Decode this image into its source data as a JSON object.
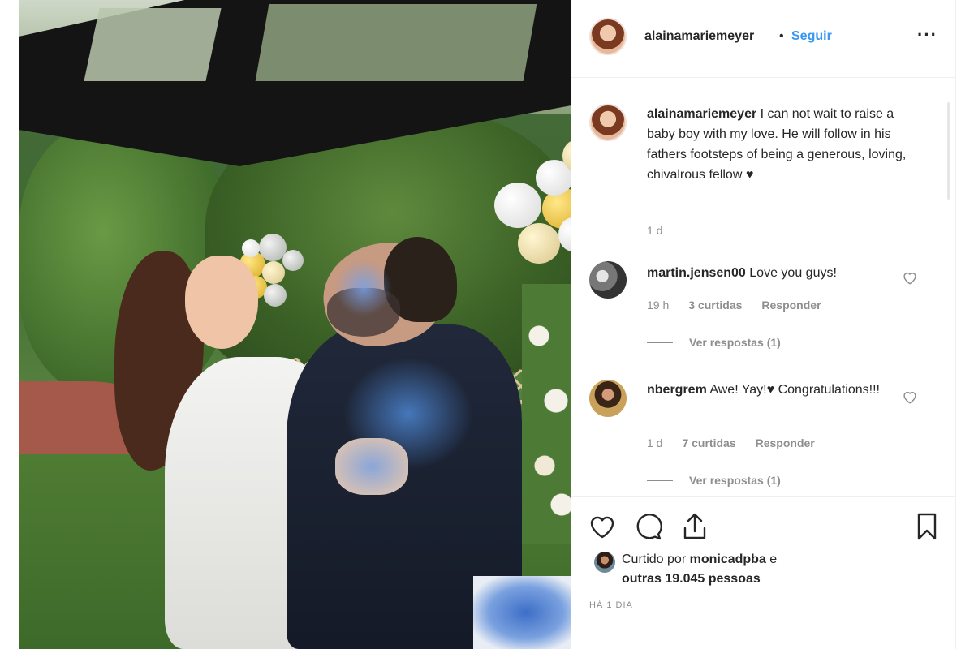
{
  "post": {
    "username": "alainamariemeyer",
    "separator": "•",
    "follow_label": "Seguir",
    "more_label": "···",
    "photo_alt_icon": "post-photo"
  },
  "caption": {
    "username": "alainamariemeyer",
    "text": "I can not wait to raise a baby boy with my love. He will follow in his fathers footsteps of being a generous, loving, chivalrous fellow ♥",
    "time": "1 d"
  },
  "comments": [
    {
      "username": "martin.jensen00",
      "text": "Love you guys!",
      "time": "19 h",
      "likes": "3 curtidas",
      "reply_label": "Responder",
      "view_replies": "Ver respostas (1)"
    },
    {
      "username": "nbergrem",
      "text": "Awe! Yay!♥ Congratulations!!!",
      "time": "1 d",
      "likes": "7 curtidas",
      "reply_label": "Responder",
      "view_replies": "Ver respostas (1)"
    }
  ],
  "likes": {
    "prefix": "Curtido por",
    "user": "monicadpba",
    "conjunction": "e",
    "others": "outras 19.045 pessoas"
  },
  "timestamp": "HÁ 1 DIA",
  "icons": {
    "like": "heart-icon",
    "comment": "comment-icon",
    "share": "share-icon",
    "save": "bookmark-icon",
    "more": "more-icon"
  },
  "colors": {
    "link": "#3897f0",
    "text": "#262626",
    "muted": "#8e8e8e",
    "border": "#efefef"
  }
}
